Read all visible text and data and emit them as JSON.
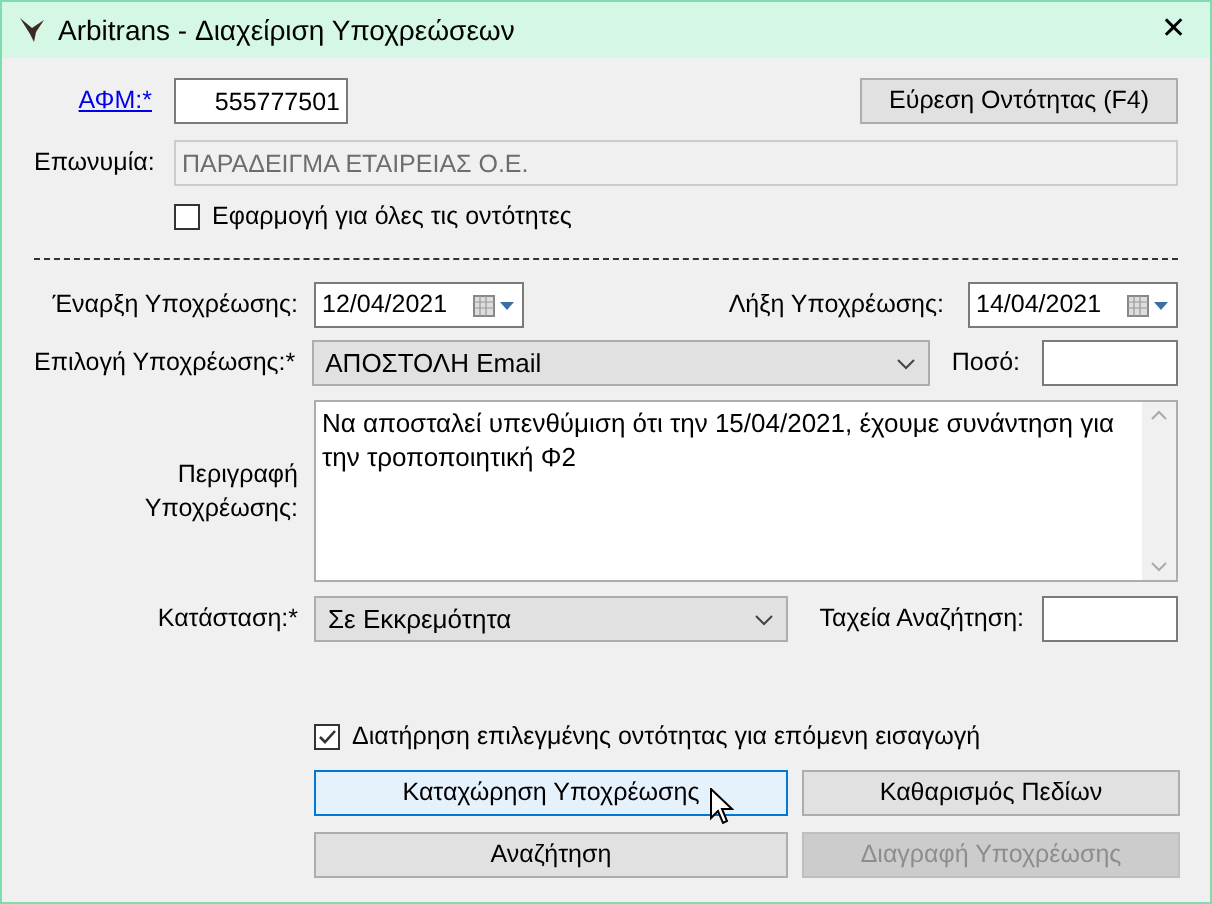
{
  "window": {
    "title": "Arbitrans - Διαχείριση Υποχρεώσεων",
    "close": "✕"
  },
  "tax_id": {
    "label": "ΑΦΜ:*",
    "value": "555777501"
  },
  "find_button": {
    "label": "Εύρεση Οντότητας (F4)"
  },
  "company_name": {
    "label": "Επωνυμία:",
    "value": "ΠΑΡΑΔΕΙΓΜΑ ΕΤΑΙΡΕΙΑΣ Ο.Ε.",
    "disabled": true
  },
  "apply_all": {
    "label": "Εφαρμογή για όλες τις οντότητες",
    "checked": false
  },
  "start_date": {
    "label": "Έναρξη Υποχρέωσης:",
    "value": "12/04/2021"
  },
  "end_date": {
    "label": "Λήξη Υποχρέωσης:",
    "value": "14/04/2021"
  },
  "obligation": {
    "label": "Επιλογή Υποχρέωσης:*",
    "value": "ΑΠΟΣΤΟΛΗ Email"
  },
  "amount": {
    "label": "Ποσό:"
  },
  "description": {
    "label": "Περιγραφή Υποχρέωσης:",
    "value": "Να αποσταλεί υπενθύμιση ότι την 15/04/2021, έχουμε συνάντηση για την τροποποιητική Φ2"
  },
  "status": {
    "label": "Κατάσταση:*",
    "value": "Σε Εκκρεμότητα"
  },
  "quick_search": {
    "label": "Ταχεία Αναζήτηση:"
  },
  "keep_entity": {
    "label": "Διατήρηση επιλεγμένης οντότητας για επόμενη εισαγωγή",
    "checked": true
  },
  "buttons": [
    {
      "label": "Καταχώρηση Υποχρέωσης",
      "disabled": false,
      "hovered": true
    },
    {
      "label": "Καθαρισμός Πεδίων",
      "disabled": false,
      "hovered": false
    },
    {
      "label": "Αναζήτηση",
      "disabled": false,
      "hovered": false
    },
    {
      "label": "Διαγραφή Υποχρέωσης",
      "disabled": true,
      "hovered": false
    }
  ]
}
